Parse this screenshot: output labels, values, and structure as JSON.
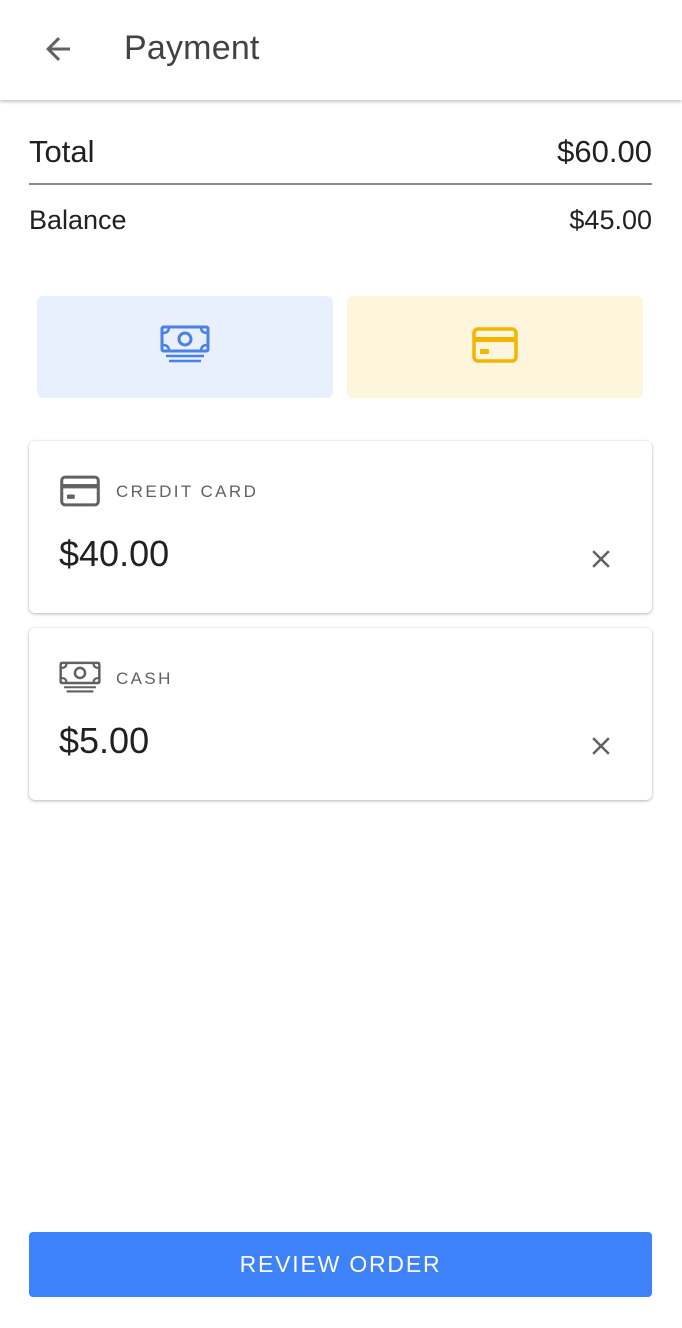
{
  "appbar": {
    "title": "Payment",
    "back_icon": "arrow-left-icon"
  },
  "summary": {
    "total_label": "Total",
    "total_value": "$60.00",
    "balance_label": "Balance",
    "balance_value": "$45.00"
  },
  "methods": [
    {
      "id": "cash",
      "icon": "cash-icon",
      "color": "#4a80e8",
      "background": "#e8f0fd"
    },
    {
      "id": "card",
      "icon": "credit-card-icon",
      "color": "#f4b400",
      "background": "#fdf6dc"
    }
  ],
  "payments": [
    {
      "type_label": "CREDIT CARD",
      "icon": "credit-card-icon",
      "amount": "$40.00",
      "remove_icon": "close-icon"
    },
    {
      "type_label": "CASH",
      "icon": "cash-icon",
      "amount": "$5.00",
      "remove_icon": "close-icon"
    }
  ],
  "actions": {
    "review_label": "REVIEW ORDER",
    "review_color": "#3d82f8"
  }
}
